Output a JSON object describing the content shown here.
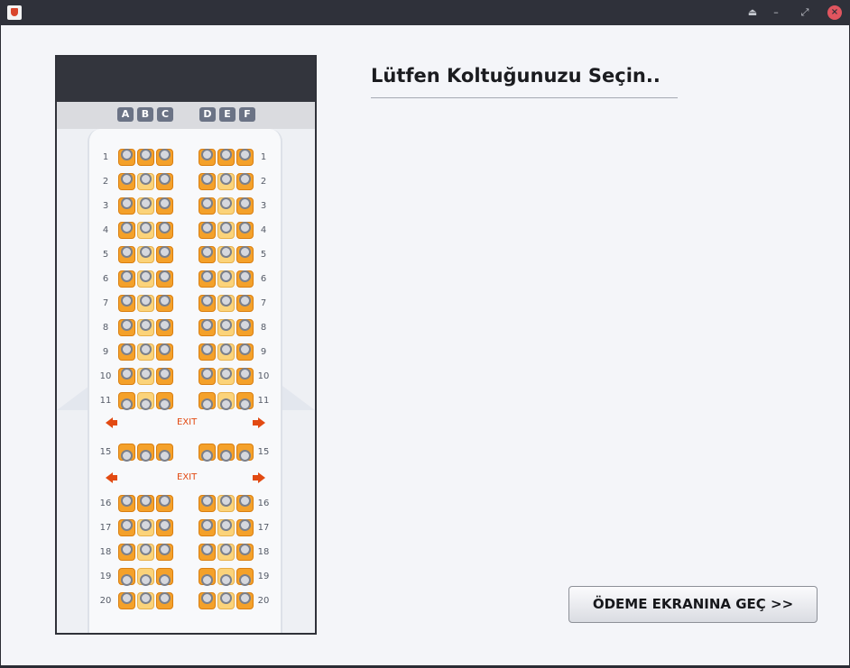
{
  "window": {
    "controls": [
      "eject-icon",
      "minimize-icon",
      "restore-icon",
      "close-icon"
    ]
  },
  "main": {
    "title": "Lütfen Koltuğunuzu Seçin..",
    "pay_button_label": "ÖDEME EKRANINA GEÇ >>"
  },
  "seatmap": {
    "columns_left": [
      "A",
      "B",
      "C"
    ],
    "columns_right": [
      "D",
      "E",
      "F"
    ],
    "exit_label": "EXIT",
    "rows": [
      {
        "num": "1",
        "orient": "up",
        "light": [
          false,
          false,
          false,
          false,
          false,
          false
        ]
      },
      {
        "num": "2",
        "orient": "up",
        "light": [
          false,
          true,
          false,
          false,
          true,
          false
        ]
      },
      {
        "num": "3",
        "orient": "up",
        "light": [
          false,
          true,
          false,
          false,
          true,
          false
        ]
      },
      {
        "num": "4",
        "orient": "up",
        "light": [
          false,
          true,
          false,
          false,
          true,
          false
        ]
      },
      {
        "num": "5",
        "orient": "up",
        "light": [
          false,
          true,
          false,
          false,
          true,
          false
        ]
      },
      {
        "num": "6",
        "orient": "up",
        "light": [
          false,
          true,
          false,
          false,
          true,
          false
        ]
      },
      {
        "num": "7",
        "orient": "up",
        "light": [
          false,
          true,
          false,
          false,
          true,
          false
        ]
      },
      {
        "num": "8",
        "orient": "up",
        "light": [
          false,
          true,
          false,
          false,
          true,
          false
        ]
      },
      {
        "num": "9",
        "orient": "up",
        "light": [
          false,
          true,
          false,
          false,
          true,
          false
        ]
      },
      {
        "num": "10",
        "orient": "up",
        "light": [
          false,
          true,
          false,
          false,
          true,
          false
        ]
      },
      {
        "num": "11",
        "orient": "down",
        "light": [
          false,
          true,
          false,
          false,
          true,
          false
        ]
      },
      {
        "num": "15",
        "orient": "down",
        "light": [
          false,
          false,
          false,
          false,
          false,
          false
        ]
      },
      {
        "num": "16",
        "orient": "up",
        "light": [
          false,
          false,
          false,
          false,
          true,
          false
        ]
      },
      {
        "num": "17",
        "orient": "up",
        "light": [
          false,
          true,
          false,
          false,
          true,
          false
        ]
      },
      {
        "num": "18",
        "orient": "up",
        "light": [
          false,
          true,
          false,
          false,
          true,
          false
        ]
      },
      {
        "num": "19",
        "orient": "down",
        "light": [
          false,
          true,
          false,
          false,
          true,
          false
        ]
      },
      {
        "num": "20",
        "orient": "up",
        "light": [
          false,
          true,
          false,
          false,
          true,
          false
        ]
      }
    ]
  },
  "colors": {
    "seat_dark": "#f4a12a",
    "seat_light": "#fbd37a",
    "exit": "#e24a12"
  }
}
